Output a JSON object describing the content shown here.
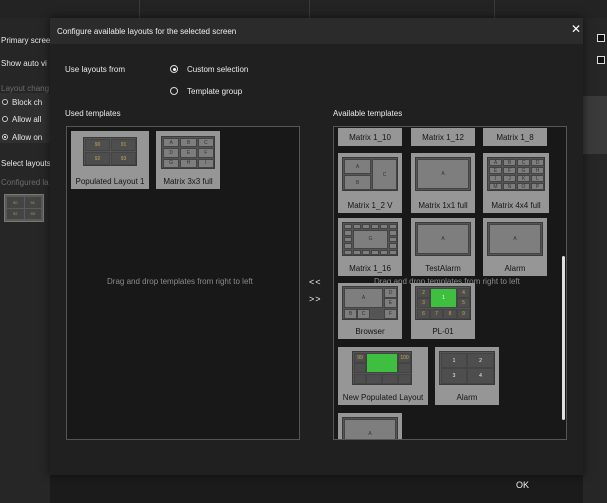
{
  "background": {
    "primary_screen_label": "Primary scree",
    "show_auto_label": "Show auto vi",
    "layout_change_label": "Layout chang",
    "radio_block": "Block ch",
    "radio_allow_all": "Allow all",
    "radio_allow_on": "Allow on",
    "select_layouts_label": "Select layouts",
    "configured_label": "Configured la",
    "thumb_cells": [
      "90",
      "91",
      "92",
      "93"
    ]
  },
  "dialog": {
    "title": "Configure available layouts for the selected screen",
    "close_icon": "close-icon",
    "use_layouts_from_label": "Use layouts from",
    "options": {
      "custom": "Custom selection",
      "group": "Template group"
    },
    "selected_option": "custom",
    "used_templates_label": "Used templates",
    "available_templates_label": "Available templates",
    "drop_hint_left": "Drag and drop templates from right to left",
    "drop_hint_right": "Drag and drop templates from right to left",
    "move_left_label": "<<",
    "move_right_label": ">>",
    "ok_label": "OK"
  },
  "used_templates": [
    {
      "name": "Populated Layout 1",
      "cells": [
        "90",
        "91",
        "92",
        "93"
      ]
    },
    {
      "name": "Matrix 3x3 full",
      "cells": [
        "A",
        "B",
        "C",
        "D",
        "E",
        "F",
        "G",
        "H",
        "I"
      ]
    }
  ],
  "available_templates": {
    "top_row": [
      "Matrix 1_10",
      "Matrix 1_12",
      "Matrix 1_8"
    ],
    "matrix_1_2v": {
      "name": "Matrix 1_2 V",
      "cells": [
        "A",
        "B",
        "C"
      ]
    },
    "matrix_1x1": {
      "name": "Matrix 1x1 full",
      "cells": [
        "A"
      ]
    },
    "matrix_4x4": {
      "name": "Matrix 4x4 full",
      "cells": [
        "A",
        "B",
        "C",
        "D",
        "E",
        "F",
        "G",
        "H",
        "I",
        "J",
        "K",
        "L",
        "M",
        "N",
        "O",
        "P"
      ]
    },
    "matrix_1_16": {
      "name": "Matrix 1_16",
      "center": "G"
    },
    "test_alarm": {
      "name": "TestAlarm",
      "cells": [
        "A"
      ]
    },
    "alarm_1": {
      "name": "Alarm",
      "cells": [
        "A"
      ]
    },
    "browser": {
      "name": "Browser",
      "cells": [
        "A",
        "D",
        "E",
        "B",
        "C",
        "F"
      ]
    },
    "pl01": {
      "name": "PL-01",
      "center": "1",
      "cells": [
        "2",
        "3",
        "4",
        "5",
        "6",
        "7",
        "8",
        "9"
      ]
    },
    "new_populated": {
      "name": "New Populated Layout",
      "cells": [
        "99",
        "100"
      ]
    },
    "alarm_2": {
      "name": "Alarm",
      "cells": [
        "1",
        "2",
        "3",
        "4"
      ]
    },
    "partial": {
      "cells": [
        "A"
      ]
    }
  },
  "colors": {
    "dialog_bg": "#202020",
    "panel_bg": "#181818",
    "tile_bg": "#969696",
    "accent_green": "#3fbf3f"
  }
}
